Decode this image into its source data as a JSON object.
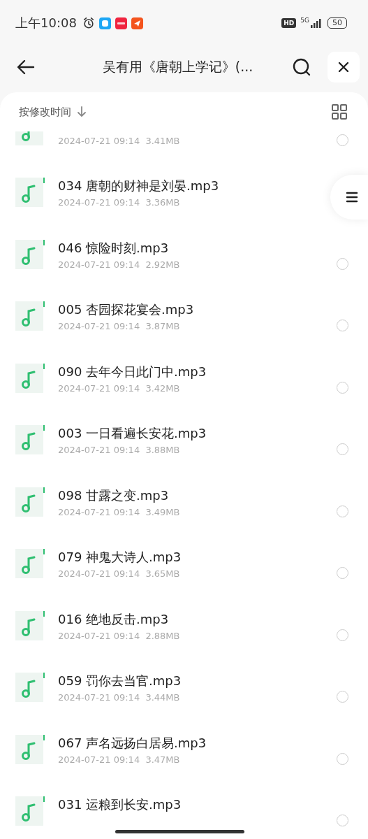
{
  "status_bar": {
    "time": "上午10:08",
    "hd": "HD",
    "network": "5G",
    "battery": "50"
  },
  "header": {
    "title": "吴有用《唐朝上学记》(..."
  },
  "sort": {
    "label": "按修改时间"
  },
  "files": [
    {
      "kind": "partial",
      "meta": "2024-07-21 09:14  3.41MB",
      "selected": false
    },
    {
      "kind": "full",
      "name": "034 唐朝的财神是刘晏.mp3",
      "meta": "2024-07-21 09:14  3.36MB"
    },
    {
      "kind": "full",
      "name": "046 惊险时刻.mp3",
      "meta": "2024-07-21 09:14  2.92MB",
      "selected": false
    },
    {
      "kind": "full",
      "name": "005 杏园探花宴会.mp3",
      "meta": "2024-07-21 09:14  3.87MB",
      "selected": false
    },
    {
      "kind": "full",
      "name": "090 去年今日此门中.mp3",
      "meta": "2024-07-21 09:14  3.42MB",
      "selected": false
    },
    {
      "kind": "full",
      "name": "003 一日看遍长安花.mp3",
      "meta": "2024-07-21 09:14  3.88MB",
      "selected": false
    },
    {
      "kind": "full",
      "name": "098 甘露之变.mp3",
      "meta": "2024-07-21 09:14  3.49MB",
      "selected": false
    },
    {
      "kind": "full",
      "name": "079 神鬼大诗人.mp3",
      "meta": "2024-07-21 09:14  3.65MB",
      "selected": false
    },
    {
      "kind": "full",
      "name": "016 绝地反击.mp3",
      "meta": "2024-07-21 09:14  2.88MB",
      "selected": false
    },
    {
      "kind": "full",
      "name": "059 罚你去当官.mp3",
      "meta": "2024-07-21 09:14  3.44MB",
      "selected": false
    },
    {
      "kind": "full",
      "name": "067 声名远扬白居易.mp3",
      "meta": "2024-07-21 09:14  3.47MB",
      "selected": false
    },
    {
      "kind": "cut",
      "name": "031 运粮到长安.mp3",
      "selected": false
    }
  ]
}
